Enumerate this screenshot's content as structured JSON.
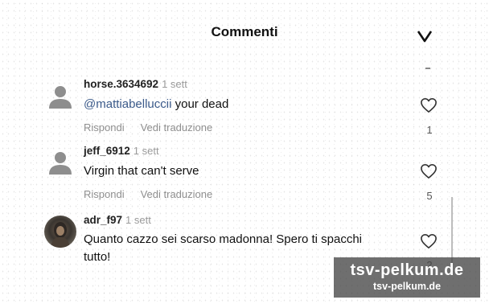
{
  "header": {
    "title": "Commenti"
  },
  "comments": [
    {
      "username": "horse.3634692",
      "time": "1 sett",
      "mention": "@mattiabelluccii",
      "text": " your dead",
      "reply_label": "Rispondi",
      "translate_label": "Vedi traduzione",
      "likes": "1"
    },
    {
      "username": "jeff_6912",
      "time": "1 sett",
      "mention": "",
      "text": "Virgin that can't serve",
      "reply_label": "Rispondi",
      "translate_label": "Vedi traduzione",
      "likes": "5"
    },
    {
      "username": "adr_f97",
      "time": "1 sett",
      "mention": "",
      "text": "Quanto cazzo sei scarso madonna! Spero ti spacchi tutto!",
      "likes": "2"
    }
  ],
  "watermark": {
    "large": "tsv-pelkum.de",
    "small": "tsv-pelkum.de"
  },
  "icons": {
    "close": "chevron-down-icon",
    "like": "heart-icon",
    "avatar_placeholder": "person-icon"
  }
}
